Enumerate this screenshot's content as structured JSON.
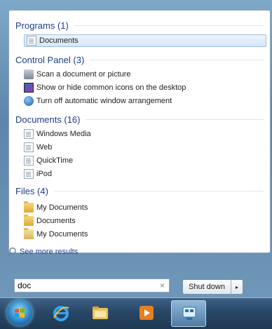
{
  "start_menu": {
    "groups": [
      {
        "header": "Programs (1)",
        "items": [
          {
            "label": "Documents",
            "icon": "document-icon",
            "selected": true
          }
        ]
      },
      {
        "header": "Control Panel (3)",
        "items": [
          {
            "label": "Scan a document or picture",
            "icon": "scanner-icon"
          },
          {
            "label": "Show or hide common icons on the desktop",
            "icon": "desktop-icon"
          },
          {
            "label": "Turn off automatic window arrangement",
            "icon": "ease-of-access-icon"
          }
        ]
      },
      {
        "header": "Documents (16)",
        "items": [
          {
            "label": "Windows Media",
            "icon": "document-icon"
          },
          {
            "label": "Web",
            "icon": "document-icon"
          },
          {
            "label": "QuickTime",
            "icon": "document-icon"
          },
          {
            "label": "iPod",
            "icon": "document-icon"
          }
        ]
      },
      {
        "header": "Files (4)",
        "items": [
          {
            "label": "My Documents",
            "icon": "folder-icon"
          },
          {
            "label": "Documents",
            "icon": "folder-icon"
          },
          {
            "label": "My Documents",
            "icon": "folder-icon"
          }
        ]
      }
    ],
    "see_more": "See more results",
    "search": {
      "value": "doc",
      "clear_glyph": "×"
    },
    "shutdown": {
      "label": "Shut down",
      "arrow_glyph": "▸"
    }
  },
  "taskbar": {
    "items": [
      {
        "name": "internet-explorer",
        "icon": "internet-explorer-icon"
      },
      {
        "name": "windows-explorer",
        "icon": "folder-icon"
      },
      {
        "name": "windows-media-player",
        "icon": "media-player-icon"
      },
      {
        "name": "connected-app",
        "icon": "network-icon",
        "active": true
      }
    ]
  },
  "colors": {
    "group_header": "#1e3d8a",
    "taskbar": "#284766",
    "selection": "#d7e7f7"
  }
}
